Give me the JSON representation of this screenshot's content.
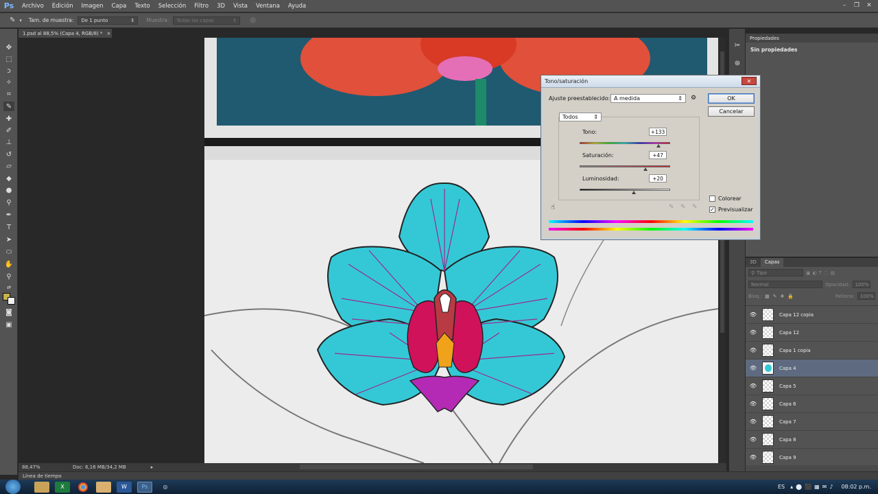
{
  "app": {
    "logo": "Ps"
  },
  "menu": [
    "Archivo",
    "Edición",
    "Imagen",
    "Capa",
    "Texto",
    "Selección",
    "Filtro",
    "3D",
    "Vista",
    "Ventana",
    "Ayuda"
  ],
  "window_controls": [
    "–",
    "❐",
    "✕"
  ],
  "options_bar": {
    "sample_size_label": "Tam. de muestra:",
    "sample_size_value": "De 1 punto",
    "sample_label": "Muestra:",
    "sample_value": "Todas las capas"
  },
  "document": {
    "tab_title": "1.psd al 88,5% (Capa 4, RGB/8) *",
    "tab_close": "×"
  },
  "status": {
    "zoom": "88,47%",
    "doc_info": "Doc: 6,16 MB/34,2 MB"
  },
  "timeline_label": "Línea de tiempo",
  "properties": {
    "tab": "Propiedades",
    "text": "Sin propiedades"
  },
  "layers": {
    "tabs": [
      "3D",
      "Capas"
    ],
    "filter_placeholder": "Tipo",
    "blend_mode": "Normal",
    "opacity_label": "Opacidad:",
    "opacity_value": "100%",
    "lock_label": "Bloq.:",
    "fill_label": "Relleno:",
    "fill_value": "100%",
    "items": [
      {
        "name": "Capa 12 copia",
        "selected": false
      },
      {
        "name": "Capa 12",
        "selected": false
      },
      {
        "name": "Capa 1 copia",
        "selected": false
      },
      {
        "name": "Capa 4",
        "selected": true
      },
      {
        "name": "Capa 5",
        "selected": false
      },
      {
        "name": "Capa 6",
        "selected": false
      },
      {
        "name": "Capa 7",
        "selected": false
      },
      {
        "name": "Capa 8",
        "selected": false
      },
      {
        "name": "Capa 9",
        "selected": false
      }
    ]
  },
  "dialog": {
    "title": "Tono/saturación",
    "close": "✕",
    "preset_label": "Ajuste preestablecido:",
    "preset_value": "A medida",
    "ok": "OK",
    "cancel": "Cancelar",
    "channel": "Todos",
    "hue_label": "Tono:",
    "hue_value": "+133",
    "hue_level": 0.87,
    "saturation_label": "Saturación:",
    "saturation_value": "+47",
    "saturation_level": 0.73,
    "lightness_label": "Luminosidad:",
    "lightness_value": "+20",
    "lightness_level": 0.6,
    "colorize_label": "Colorear",
    "colorize_checked": false,
    "preview_label": "Previsualizar",
    "preview_checked": true
  },
  "taskbar": {
    "language": "ES",
    "clock": "08:02 p.m.",
    "apps": [
      "folder-icon",
      "excel-icon",
      "chrome-icon",
      "explorer-icon",
      "word-icon",
      "photoshop-icon",
      "media-icon"
    ]
  },
  "colors": {
    "foreground": "#c8b24a",
    "background": "#f2f2f2",
    "selected_layer": "#5e6a7f",
    "orchid_petal": "#34c8d6",
    "orchid_vein": "#9a2a8a",
    "orchid_center": "#d0125a"
  }
}
